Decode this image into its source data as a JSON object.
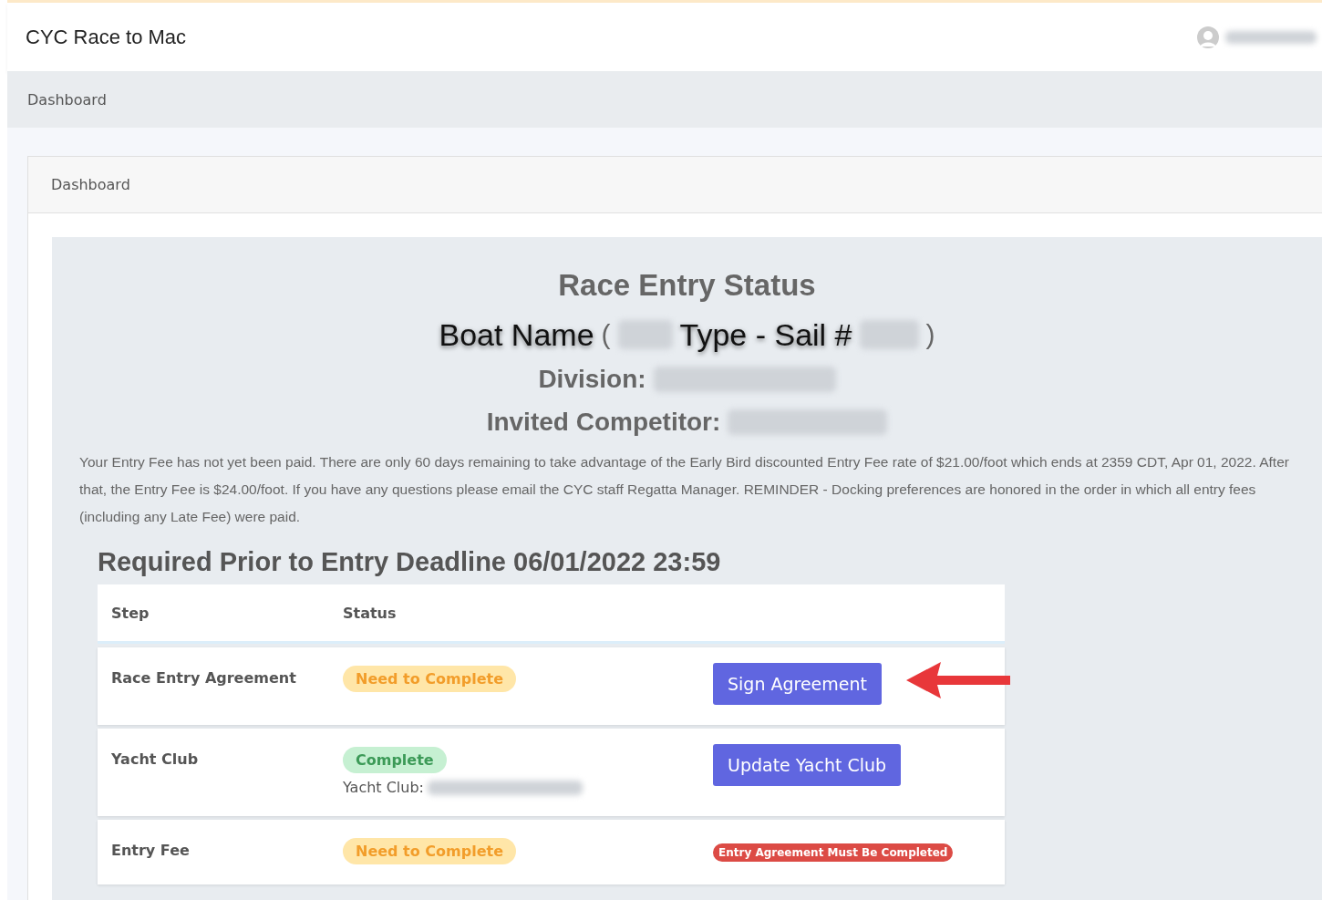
{
  "app_title": "CYC Race to Mac",
  "breadcrumb": "Dashboard",
  "card_title": "Dashboard",
  "status_panel": {
    "heading": "Race Entry Status",
    "boat_name": "Boat Name",
    "open_paren": "(",
    "type_sail": "Type - Sail #",
    "close_paren": ")",
    "division_label": "Division:",
    "competitor_label": "Invited Competitor:",
    "notice": "Your Entry Fee has not yet been paid. There are only 60 days remaining to take advantage of the Early Bird discounted Entry Fee rate of $21.00/foot which ends at 2359 CDT, Apr 01, 2022. After that, the Entry Fee is $24.00/foot. If you have any questions please email the CYC staff Regatta Manager. REMINDER - Docking preferences are honored in the order in which all entry fees (including any Late Fee) were paid.",
    "requirements_heading": "Required Prior to Entry Deadline 06/01/2022 23:59"
  },
  "table": {
    "columns": [
      "Step",
      "Status"
    ],
    "rows": [
      {
        "step": "Race Entry Agreement",
        "status": {
          "kind": "warning",
          "label": "Need to Complete"
        },
        "action": {
          "kind": "button",
          "label": "Sign Agreement"
        },
        "pointer_arrow": true
      },
      {
        "step": "Yacht Club",
        "status": {
          "kind": "success",
          "label": "Complete"
        },
        "detail_label": "Yacht Club:",
        "action": {
          "kind": "button",
          "label": "Update Yacht Club"
        },
        "pointer_arrow": false
      },
      {
        "step": "Entry Fee",
        "status": {
          "kind": "warning",
          "label": "Need to Complete"
        },
        "action": {
          "kind": "alert",
          "label": "Entry Agreement Must Be Completed"
        },
        "pointer_arrow": false
      }
    ]
  }
}
